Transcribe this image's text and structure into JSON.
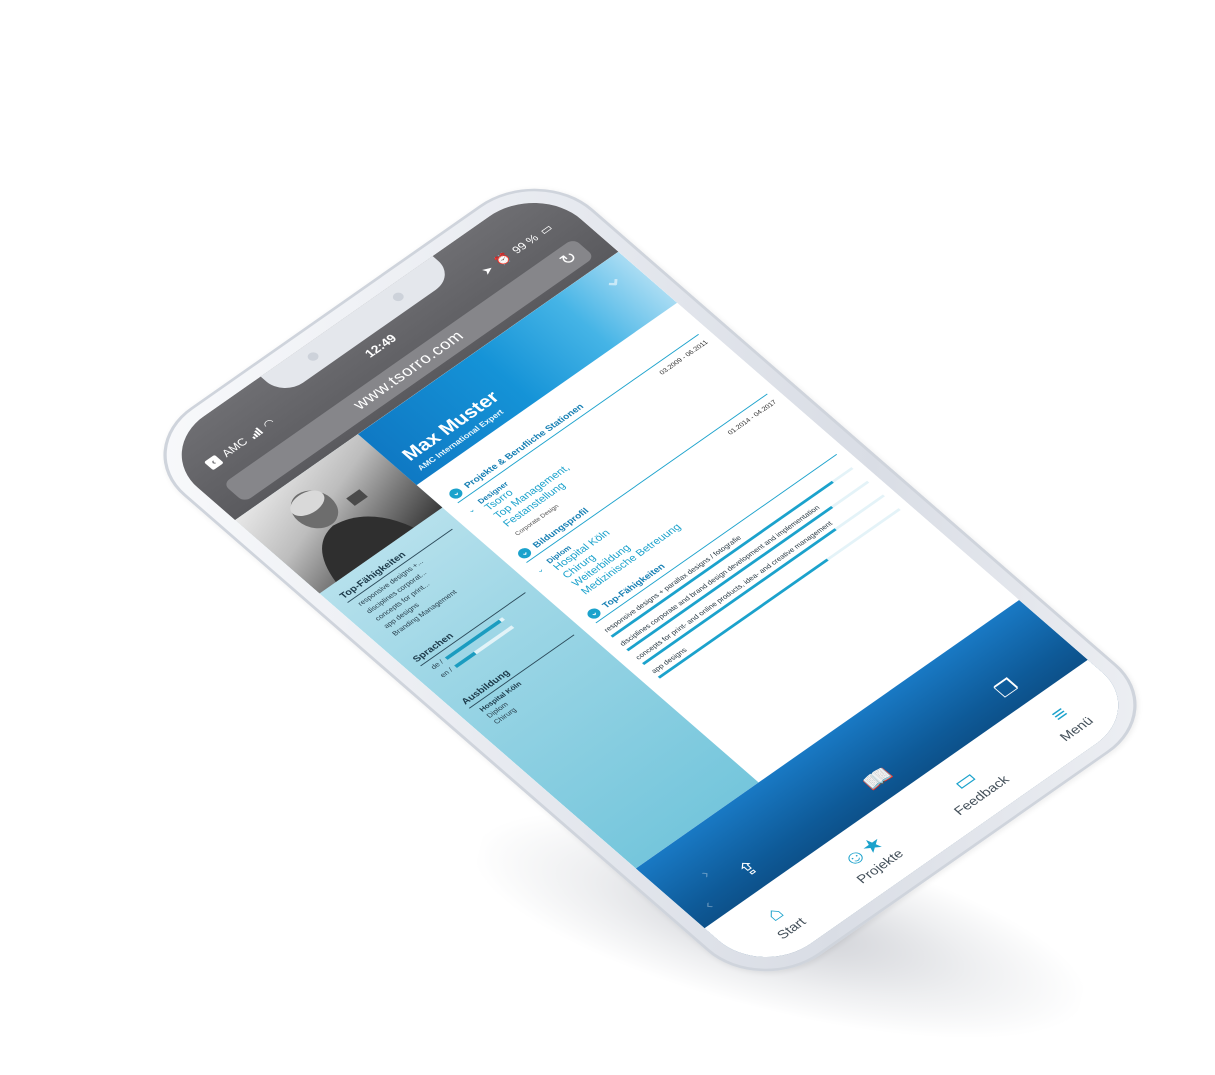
{
  "browser": {
    "carrier": "AMC",
    "time": "12:49",
    "battery": "99 %",
    "url": "www.tsorro.com"
  },
  "profile": {
    "name": "Max Muster",
    "subtitle": "AMC International Expert"
  },
  "sidebar": {
    "skills_title": "Top-Fähigkeiten",
    "skills": [
      "responsive designs +...",
      "disciplines corporat...",
      "concepts for print...",
      "app designs",
      "Branding Management"
    ],
    "languages_title": "Sprachen",
    "languages": [
      {
        "label": "de /",
        "level": 0.95
      },
      {
        "label": "en /",
        "level": 0.35
      }
    ],
    "education_title": "Ausbildung",
    "education": {
      "school": "Hospital Köln",
      "degree": "Diplom",
      "field": "Chirurg"
    }
  },
  "sections": {
    "projects_title": "Projekte & Berufliche Stationen",
    "project": {
      "role": "Designer",
      "lines": [
        "Tsorro",
        "Top Management,",
        "Festanstellung"
      ],
      "note": "Corporate Design",
      "date": "03.2009 - 06.2011"
    },
    "education_title": "Bildungsprofil",
    "education": {
      "role": "Diplom",
      "lines": [
        "Hospital Köln",
        "Chirurg",
        "Weiterbildung",
        "Medizinische Betreuung"
      ],
      "date": "01.2014 - 04.2017"
    },
    "skills_title": "Top-Fähigkeiten",
    "skills": [
      {
        "label": "responsive designs + parallax designs / fotografie",
        "level": 0.92
      },
      {
        "label": "disciplines corporate and brand design development and implementation",
        "level": 0.85
      },
      {
        "label": "concepts for print- and online products, idea- and creative management",
        "level": 0.8
      },
      {
        "label": "app designs",
        "level": 0.7
      }
    ]
  },
  "tabbar": {
    "start": "Start",
    "projekte": "Projekte",
    "feedback": "Feedback",
    "menu": "Menü"
  },
  "icons": {
    "reload": "reload-icon",
    "home": "home-icon",
    "projects": "person-star-icon",
    "feedback": "speech-bubble-icon",
    "share": "share-icon",
    "bookmarks": "book-icon",
    "tabs": "tabs-icon",
    "menu": "hamburger-icon"
  },
  "colors": {
    "accent": "#1ba2cc",
    "hero": "#1593d7",
    "chrome": "#5a5a5e"
  }
}
